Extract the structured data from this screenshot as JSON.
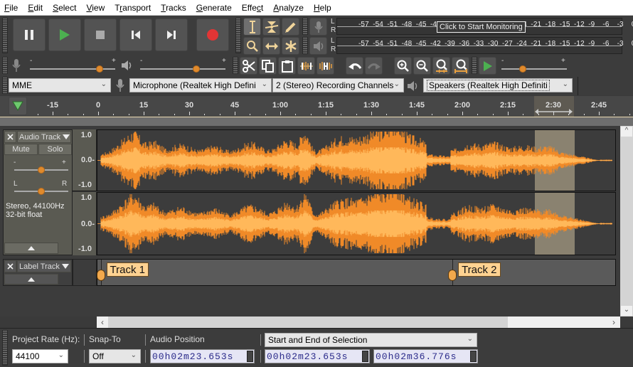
{
  "menubar": {
    "items": [
      {
        "label": "File",
        "mnemonic": "F"
      },
      {
        "label": "Edit",
        "mnemonic": "E"
      },
      {
        "label": "Select",
        "mnemonic": "S"
      },
      {
        "label": "View",
        "mnemonic": "V"
      },
      {
        "label": "Transport",
        "mnemonic": "r"
      },
      {
        "label": "Tracks",
        "mnemonic": "T"
      },
      {
        "label": "Generate",
        "mnemonic": "G"
      },
      {
        "label": "Effect",
        "mnemonic": "c"
      },
      {
        "label": "Analyze",
        "mnemonic": "A"
      },
      {
        "label": "Help",
        "mnemonic": "H"
      }
    ]
  },
  "transport": {
    "buttons": [
      "pause",
      "play",
      "stop",
      "skip-to-start",
      "skip-to-end",
      "record"
    ],
    "colors": {
      "play": "#4cb050",
      "record": "#e23535",
      "icon": "#e8e8e8"
    }
  },
  "tools": [
    "selection-tool",
    "envelope-tool",
    "draw-tool",
    "zoom-tool",
    "time-shift-tool",
    "multi-tool"
  ],
  "meters": {
    "scale": [
      "-57",
      "-54",
      "-51",
      "-48",
      "-45",
      "-42",
      "-39",
      "-36",
      "-33",
      "-30",
      "-27",
      "-24",
      "-21",
      "-18",
      "-15",
      "-12",
      "-9",
      "-6",
      "-3",
      "0"
    ],
    "record_tooltip": "Click to Start Monitoring",
    "channels": [
      "L",
      "R"
    ]
  },
  "mixer": {
    "record_volume": 0.82,
    "playback_volume": 0.66,
    "minus": "-",
    "plus": "+"
  },
  "play_at_speed": {
    "speed": 0.33
  },
  "devices": {
    "host": "MME",
    "input": "Microphone (Realtek High Defini",
    "channels": "2 (Stereo) Recording Channels",
    "output": "Speakers (Realtek High Definiti"
  },
  "timeline": {
    "ticks": [
      "-15",
      "0",
      "15",
      "30",
      "45",
      "1:00",
      "1:15",
      "1:30",
      "1:45",
      "2:00",
      "2:15",
      "2:30",
      "2:45"
    ],
    "selection_start_s": 143.653,
    "selection_end_s": 156.776
  },
  "audio_track": {
    "name": "Audio Track",
    "mute": "Mute",
    "solo": "Solo",
    "gain_minus": "-",
    "gain_plus": "+",
    "pan_left": "L",
    "pan_right": "R",
    "gain": 0.5,
    "pan": 0.5,
    "info1": "Stereo, 44100Hz",
    "info2": "32-bit float",
    "scale": [
      "1.0",
      "0.0-",
      "-1.0"
    ],
    "wave_color": "#f3a13a"
  },
  "label_track": {
    "name": "Label Track",
    "labels": [
      {
        "text": "Track 1",
        "time_s": 0.6
      },
      {
        "text": "Track 2",
        "time_s": 116.5
      }
    ]
  },
  "selection_toolbar": {
    "project_rate_label": "Project Rate (Hz):",
    "project_rate": "44100",
    "snap_to_label": "Snap-To",
    "snap_to": "Off",
    "audio_position_label": "Audio Position",
    "audio_position": "00h02m23.653s",
    "selection_mode": "Start and End of Selection",
    "selection_start": "00h02m23.653s",
    "selection_end": "00h02m36.776s"
  }
}
